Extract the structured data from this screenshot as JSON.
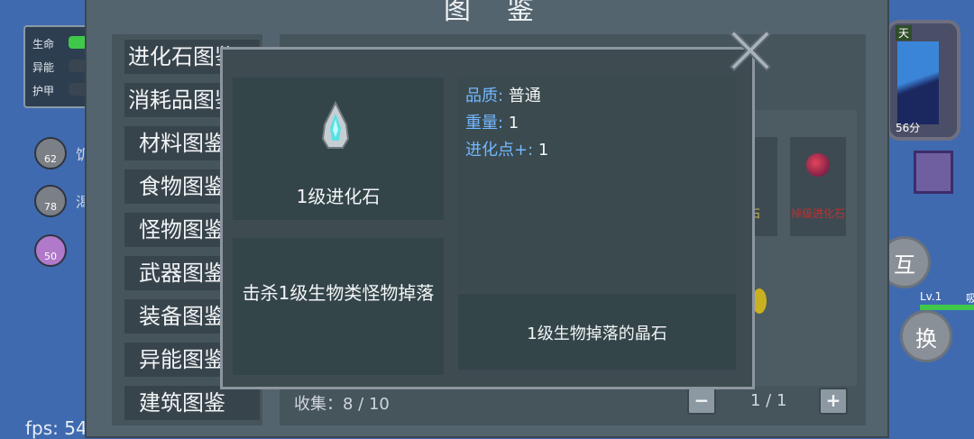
{
  "hud": {
    "stats": [
      {
        "label": "生命",
        "active": true
      },
      {
        "label": "异能",
        "active": false
      },
      {
        "label": "护甲",
        "active": false
      }
    ],
    "buffs": [
      {
        "value": "62",
        "icon": "bone-icon",
        "extra": "饥"
      },
      {
        "value": "78",
        "icon": "drop-icon",
        "extra": "渴"
      },
      {
        "value": "50",
        "icon": "heart-icon"
      }
    ],
    "fps": "fps: 54"
  },
  "clock": {
    "label": "天",
    "time": "56分"
  },
  "right_buttons": {
    "interact": "互",
    "switch": "换"
  },
  "level": {
    "label": "Lv.1",
    "bar_label": "吸"
  },
  "codex": {
    "title": "图鉴",
    "categories": [
      "进化石图鉴",
      "消耗品图鉴",
      "材料图鉴",
      "食物图鉴",
      "怪物图鉴",
      "武器图鉴",
      "装备图鉴",
      "异能图鉴",
      "建筑图鉴"
    ],
    "grid_items": [
      {
        "name": "化石",
        "color": "#e0c040"
      },
      {
        "name": "掉级进化石",
        "color": "#c03030"
      }
    ],
    "collect": "收集：8 / 10",
    "page": "1 / 1",
    "prev_label": "−",
    "next_label": "+"
  },
  "detail": {
    "name": "1级进化石",
    "source": "击杀1级生物类怪物掉落",
    "attributes": [
      {
        "key": "品质: ",
        "value": "普通"
      },
      {
        "key": "重量: ",
        "value": "1"
      },
      {
        "key": "进化点+: ",
        "value": "1"
      }
    ],
    "description": "1级生物掉落的晶石"
  }
}
